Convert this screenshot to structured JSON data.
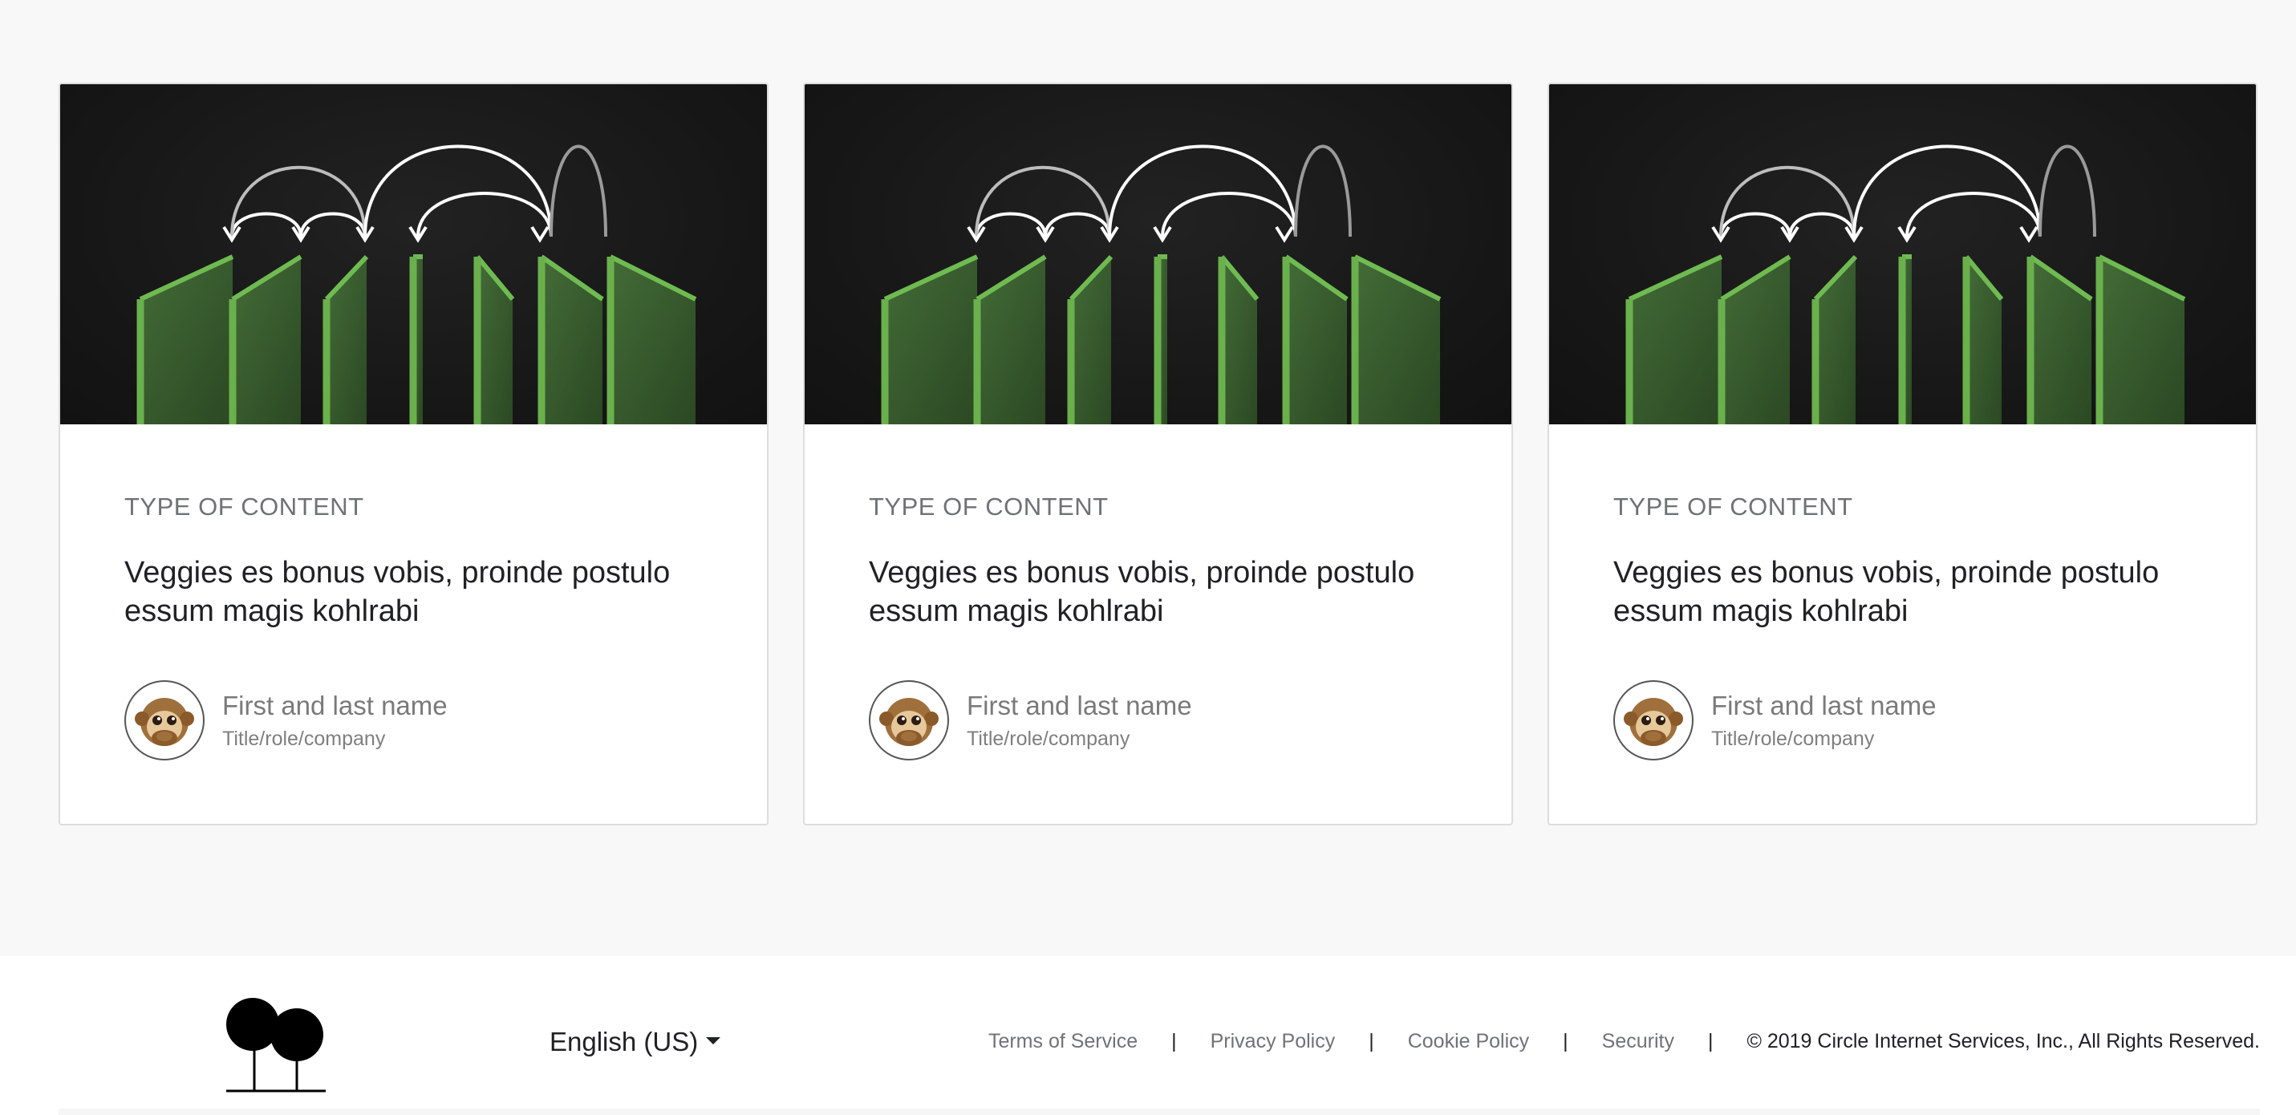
{
  "cards": [
    {
      "content_type": "TYPE OF CONTENT",
      "title": "Veggies es bonus vobis, proinde postulo essum magis kohlrabi",
      "author_name": "First and last name",
      "author_role": "Title/role/company",
      "avatar_icon": "see-no-evil-monkey-icon"
    },
    {
      "content_type": "TYPE OF CONTENT",
      "title": "Veggies es bonus vobis, proinde postulo essum magis kohlrabi",
      "author_name": "First and last name",
      "author_role": "Title/role/company",
      "avatar_icon": "see-no-evil-monkey-icon"
    },
    {
      "content_type": "TYPE OF CONTENT",
      "title": "Veggies es bonus vobis, proinde postulo essum magis kohlrabi",
      "author_name": "First and last name",
      "author_role": "Title/role/company",
      "avatar_icon": "see-no-evil-monkey-icon"
    }
  ],
  "footer": {
    "language": "English (US)",
    "links": [
      "Terms of Service",
      "Privacy Policy",
      "Cookie Policy",
      "Security"
    ],
    "copyright": "© 2019 Circle Internet Services, Inc., All Rights Reserved."
  },
  "colors": {
    "accent_green": "#6ab04c",
    "panel_green": "#3f6a32",
    "image_bg": "#161616"
  }
}
